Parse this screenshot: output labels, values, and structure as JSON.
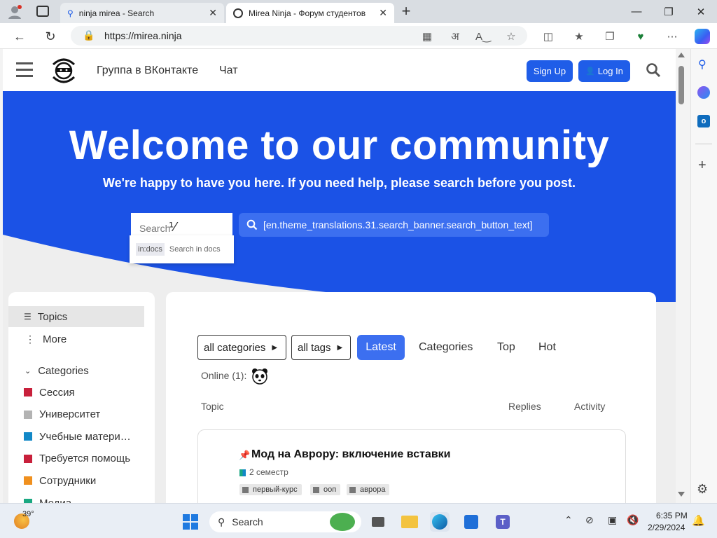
{
  "browser": {
    "tabs": [
      {
        "title": "ninja mirea - Search",
        "active": false
      },
      {
        "title": "Mirea Ninja - Форум студентов",
        "active": true
      }
    ],
    "new_tab_label": "+",
    "url": "https://mirea.ninja"
  },
  "site": {
    "logo_text": "MIREA NINJA",
    "nav": [
      "Группа в ВКонтакте",
      "Чат"
    ],
    "signup_label": "Sign Up",
    "login_label": "Log In",
    "hero_title": "Welcome to our community",
    "hero_subtitle": "We're happy to have you here. If you need help, please search before you post.",
    "search_placeholder": "Search",
    "search_button_text": "[en.theme_translations.31.search_banner.search_button_text]",
    "search_suggestion": {
      "tag": "in:docs",
      "text": "Search in docs"
    }
  },
  "sidebar": {
    "topics_label": "Topics",
    "more_label": "More",
    "categories_label": "Categories",
    "categories": [
      {
        "name": "Сессия",
        "color": "#c8203b"
      },
      {
        "name": "Университет",
        "color": "#b3b3b3"
      },
      {
        "name": "Учебные матери…",
        "color": "#1288c7"
      },
      {
        "name": "Требуется помощь",
        "color": "#c8203b"
      },
      {
        "name": "Сотрудники",
        "color": "#f0901e"
      },
      {
        "name": "Медиа",
        "color": "#1aa882"
      }
    ]
  },
  "main": {
    "filters": [
      "all categories",
      "all tags"
    ],
    "tabs": [
      {
        "label": "Latest",
        "active": true
      },
      {
        "label": "Categories",
        "active": false
      },
      {
        "label": "Top",
        "active": false
      },
      {
        "label": "Hot",
        "active": false
      }
    ],
    "online_label": "Online (1):",
    "columns": [
      "Topic",
      "Replies",
      "Activity"
    ],
    "topics": [
      {
        "title": "Мод на Аврору: включение вставки",
        "pinned": true,
        "category": "2 семестр",
        "tags": [
          "первый-курс",
          "ооп",
          "аврора"
        ]
      }
    ]
  },
  "taskbar": {
    "weather": "39°",
    "search_label": "Search",
    "time": "6:35 PM",
    "date": "2/29/2024"
  }
}
